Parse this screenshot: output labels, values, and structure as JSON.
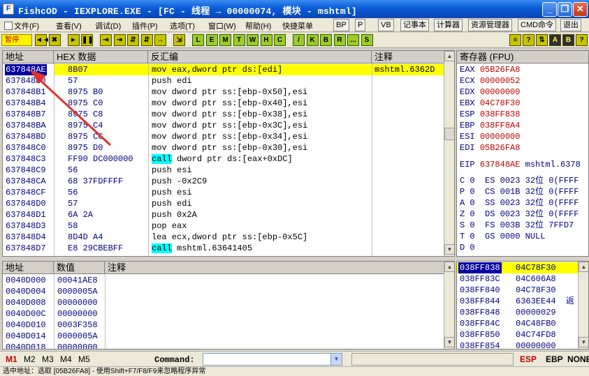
{
  "window": {
    "title": "FishcOD - IEXPLORE.EXE - [FC - 线程 → 00000074, 模块 - mshtml]",
    "icon_label": "F"
  },
  "menu": {
    "items": [
      "文件(F)",
      "查看(V)",
      "调试(D)",
      "插件(P)",
      "选项(T)",
      "窗口(W)",
      "帮助(H)",
      "快捷菜单"
    ],
    "tools": [
      "BP",
      "P",
      "VB",
      "记事本",
      "计算器",
      "资源管理器",
      "CMD命令",
      "退出"
    ]
  },
  "toolbar": {
    "status": "暂停",
    "buttons": [
      "◄◄",
      "✖",
      "►",
      "❚❚",
      "⇥",
      "⇥",
      "⇵",
      "⇵",
      "→",
      "⇲",
      "L",
      "E",
      "M",
      "T",
      "W",
      "H",
      "C",
      "/",
      "K",
      "B",
      "R",
      "...",
      "S"
    ],
    "right_buttons": [
      "≡",
      "?",
      "⇅",
      "A",
      "B",
      "?"
    ]
  },
  "disasm": {
    "headers": [
      "地址",
      "HEX 数据",
      "反汇编",
      "注释"
    ],
    "rows": [
      {
        "addr": "637848AE",
        "hex": "8B07",
        "asm": "mov eax,dword ptr ds:[edi]",
        "comment": "mshtml.6362D"
      },
      {
        "addr": "637848B0",
        "hex": "57",
        "asm": "push edi",
        "comment": ""
      },
      {
        "addr": "637848B1",
        "hex": "8975 B0",
        "asm": "mov dword ptr ss:[ebp-0x50],esi",
        "comment": ""
      },
      {
        "addr": "637848B4",
        "hex": "8975 C0",
        "asm": "mov dword ptr ss:[ebp-0x40],esi",
        "comment": ""
      },
      {
        "addr": "637848B7",
        "hex": "8975 C8",
        "asm": "mov dword ptr ss:[ebp-0x38],esi",
        "comment": ""
      },
      {
        "addr": "637848BA",
        "hex": "8975 C4",
        "asm": "mov dword ptr ss:[ebp-0x3C],esi",
        "comment": ""
      },
      {
        "addr": "637848BD",
        "hex": "8975 CC",
        "asm": "mov dword ptr ss:[ebp-0x34],esi",
        "comment": ""
      },
      {
        "addr": "637848C0",
        "hex": "8975 D0",
        "asm": "mov dword ptr ss:[ebp-0x30],esi",
        "comment": ""
      },
      {
        "addr": "637848C3",
        "hex": "FF90 DC000000",
        "asm_kw": "call",
        "asm": " dword ptr ds:[eax+0xDC]",
        "comment": ""
      },
      {
        "addr": "637848C9",
        "hex": "56",
        "asm": "push esi",
        "comment": ""
      },
      {
        "addr": "637848CA",
        "hex": "68 37FDFFFF",
        "asm": "push -0x2C9",
        "comment": ""
      },
      {
        "addr": "637848CF",
        "hex": "56",
        "asm": "push esi",
        "comment": ""
      },
      {
        "addr": "637848D0",
        "hex": "57",
        "asm": "push edi",
        "comment": ""
      },
      {
        "addr": "637848D1",
        "hex": "6A 2A",
        "asm": "push 0x2A",
        "comment": ""
      },
      {
        "addr": "637848D3",
        "hex": "58",
        "asm": "pop eax",
        "comment": ""
      },
      {
        "addr": "637848D4",
        "hex": "8D4D A4",
        "asm": "lea ecx,dword ptr ss:[ebp-0x5C]",
        "comment": ""
      },
      {
        "addr": "637848D7",
        "hex": "E8 29CBEBFF",
        "asm_kw": "call",
        "asm": " mshtml.63641405",
        "comment": ""
      }
    ]
  },
  "registers": {
    "header": "寄存器 (FPU)",
    "gp": [
      {
        "name": "EAX",
        "value": "05B26FA8"
      },
      {
        "name": "ECX",
        "value": "00000052"
      },
      {
        "name": "EDX",
        "value": "00000000"
      },
      {
        "name": "EBX",
        "value": "04C78F30"
      },
      {
        "name": "ESP",
        "value": "038FF838"
      },
      {
        "name": "EBP",
        "value": "038FF8A4"
      },
      {
        "name": "ESI",
        "value": "00000000"
      },
      {
        "name": "EDI",
        "value": "05B26FA8"
      }
    ],
    "eip": {
      "name": "EIP",
      "value": "637848AE",
      "extra": "mshtml.6378"
    },
    "flags": [
      {
        "flag": "C 0",
        "seg": "ES 0023",
        "bits": "32位",
        "base": "0(FFFF"
      },
      {
        "flag": "P 0",
        "seg": "CS 001B",
        "bits": "32位",
        "base": "0(FFFF"
      },
      {
        "flag": "A 0",
        "seg": "SS 0023",
        "bits": "32位",
        "base": "0(FFFF"
      },
      {
        "flag": "Z 0",
        "seg": "DS 0023",
        "bits": "32位",
        "base": "0(FFFF"
      },
      {
        "flag": "S 0",
        "seg": "FS 003B",
        "bits": "32位",
        "base": "7FFD7"
      },
      {
        "flag": "T 0",
        "seg": "GS 0000",
        "bits": "NULL",
        "base": ""
      }
    ],
    "d_flag": "D 0"
  },
  "dump": {
    "headers": [
      "地址",
      "数值",
      "注释"
    ],
    "rows": [
      {
        "addr": "0040D000",
        "value": "00041AE8"
      },
      {
        "addr": "0040D004",
        "value": "0000005A"
      },
      {
        "addr": "0040D008",
        "value": "00000000"
      },
      {
        "addr": "0040D00C",
        "value": "00000000"
      },
      {
        "addr": "0040D010",
        "value": "0003F358"
      },
      {
        "addr": "0040D014",
        "value": "0000005A"
      },
      {
        "addr": "0040D018",
        "value": "00000000"
      }
    ]
  },
  "stack": {
    "rows": [
      {
        "addr": "038FF838",
        "value": "04C78F30",
        "note": ""
      },
      {
        "addr": "038FF83C",
        "value": "04C606A8",
        "note": ""
      },
      {
        "addr": "038FF840",
        "value": "04C78F30",
        "note": ""
      },
      {
        "addr": "038FF844",
        "value": "6363EE44",
        "note": "返"
      },
      {
        "addr": "038FF848",
        "value": "00000029",
        "note": ""
      },
      {
        "addr": "038FF84C",
        "value": "04C48FB0",
        "note": ""
      },
      {
        "addr": "038FF850",
        "value": "04C74FD8",
        "note": ""
      },
      {
        "addr": "038FF854",
        "value": "00000000",
        "note": ""
      }
    ]
  },
  "command": {
    "tabs": [
      "M1",
      "M2",
      "M3",
      "M4",
      "M5"
    ],
    "label": "Command:",
    "value": "",
    "right": [
      "ESP",
      "EBP",
      "NONE"
    ]
  },
  "status": {
    "text": "选中地址：选取 [05B26FA8] - 使用Shift+F7/F8/F9来忽略程序异常"
  },
  "colors": {
    "selected_row": "#ffff00",
    "call_highlight": "#00ffff",
    "register_value": "#c00000",
    "arrow": "#e03030"
  }
}
